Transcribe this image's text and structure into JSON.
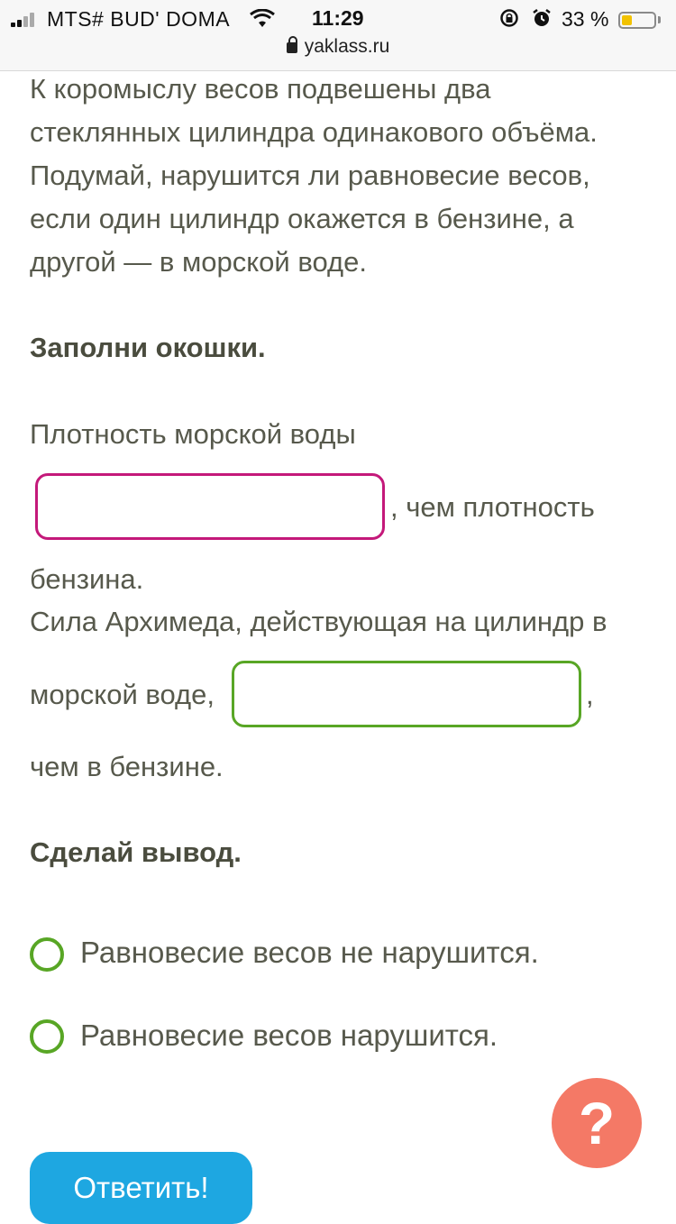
{
  "status_bar": {
    "carrier": "MTS# BUD' DOMA",
    "time": "11:29",
    "battery_percent": "33 %",
    "battery_level": 0.33,
    "url": "yaklass.ru",
    "icons": [
      "signal-icon",
      "wifi-icon",
      "rotation-lock-icon",
      "alarm-icon",
      "battery-icon",
      "padlock-icon"
    ]
  },
  "task": {
    "intro_lines": [
      "К коромыслу весов подвешены два",
      "стеклянных цилиндра одинакового объёма.",
      "Подумай, нарушится ли равновесие весов,",
      "если один цилиндр окажется в бензине, а",
      "другой — в морской воде."
    ],
    "fill_heading": "Заполни окошки.",
    "sentence1_start": "Плотность морской воды",
    "sentence1_after_input": ", чем плотность",
    "sentence1_end": "бензина.",
    "sentence2_start": "Сила Архимеда, действующая на цилиндр в",
    "sentence2_before_input": "морской воде,",
    "sentence2_after_input": ",",
    "sentence2_end": "чем в бензине.",
    "input1_value": "",
    "input2_value": "",
    "conclusion_heading": "Сделай вывод.",
    "options": [
      "Равновесие весов не нарушится.",
      "Равновесие весов нарушится."
    ]
  },
  "help_button_label": "?",
  "submit_button_label": "Ответить!",
  "colors": {
    "input1_border": "#c4197a",
    "input2_border": "#58a625",
    "radio_border": "#58a625",
    "help_button": "#f47966",
    "submit_button": "#1ea7e1",
    "battery_fill": "#f2c200"
  }
}
